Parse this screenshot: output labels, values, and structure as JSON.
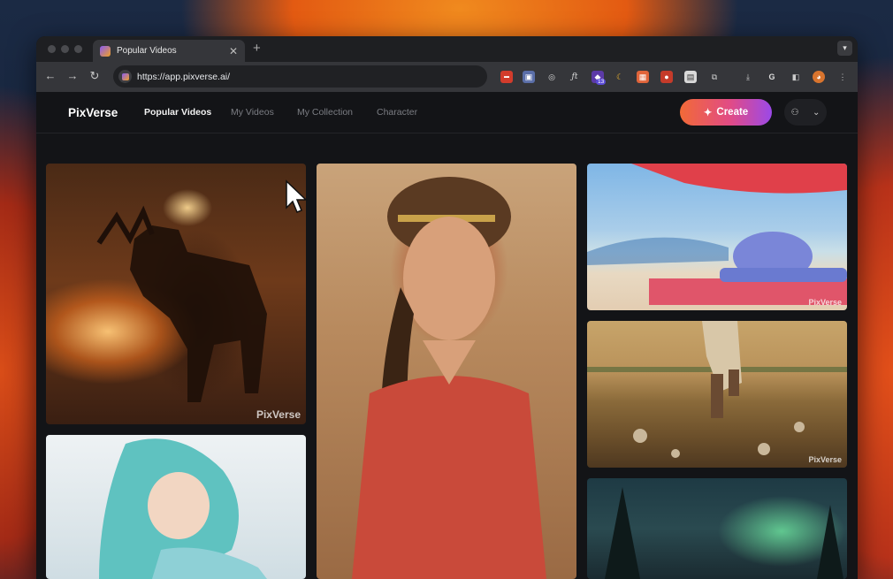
{
  "browser": {
    "tab_title": "Popular Videos",
    "tab_close": "✕",
    "new_tab": "+",
    "url": "https://app.pixverse.ai/",
    "extension_badge": "13"
  },
  "app": {
    "logo": "PixVerse",
    "nav": [
      {
        "label": "Popular Videos",
        "active": true
      },
      {
        "label": "My Videos",
        "active": false
      },
      {
        "label": "My Collection",
        "active": false
      },
      {
        "label": "Character",
        "active": false
      }
    ],
    "create_label": "Create",
    "watermark": "PixVerse"
  },
  "gallery": [
    {
      "subject": "moose-in-fire",
      "watermark": "PixVerse"
    },
    {
      "subject": "woman-with-braided-hair",
      "watermark": ""
    },
    {
      "subject": "beach-umbrella-and-hat",
      "watermark": "PixVerse"
    },
    {
      "subject": "walking-on-dirt-path",
      "watermark": "PixVerse"
    },
    {
      "subject": "anime-girl-teal-hair",
      "watermark": ""
    },
    {
      "subject": "aurora-forest",
      "watermark": ""
    }
  ],
  "colors": {
    "create_gradient": [
      "#f26a37",
      "#e14b86",
      "#9b49e8"
    ],
    "app_background": "#131417"
  }
}
